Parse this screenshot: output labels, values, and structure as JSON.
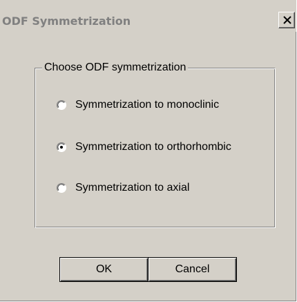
{
  "window": {
    "title": "ODF Symmetrization",
    "close_icon": "close-icon"
  },
  "group": {
    "legend": "Choose ODF symmetrization",
    "options": [
      {
        "label": "Symmetrization to monoclinic",
        "selected": false
      },
      {
        "label": "Symmetrization to orthorhombic",
        "selected": true
      },
      {
        "label": "Symmetrization to axial",
        "selected": false
      }
    ]
  },
  "buttons": {
    "ok_label": "OK",
    "cancel_label": "Cancel"
  },
  "colors": {
    "dialog_face": "#d4d0c8",
    "title_text": "#808080",
    "shadow": "#808080",
    "highlight": "#ffffff"
  }
}
